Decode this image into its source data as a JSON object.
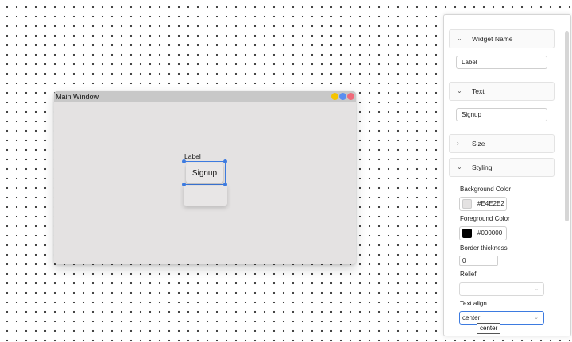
{
  "canvas": {
    "window_title": "Main Window",
    "window_buttons": [
      {
        "name": "minimize-dot",
        "color": "#f5c400"
      },
      {
        "name": "maximize-dot",
        "color": "#5b8ef0"
      },
      {
        "name": "close-dot",
        "color": "#f06a7a"
      }
    ],
    "label_text": "Label",
    "selected_button_text": "Signup"
  },
  "panel": {
    "widget_name": {
      "heading": "Widget Name",
      "value": "Label"
    },
    "text": {
      "heading": "Text",
      "value": "Signup"
    },
    "size": {
      "heading": "Size"
    },
    "styling": {
      "heading": "Styling",
      "bg_label": "Background Color",
      "bg_value": "#E4E2E2",
      "bg_swatch": "#e4e2e2",
      "fg_label": "Foreground Color",
      "fg_value": "#000000",
      "fg_swatch": "#000000",
      "border_label": "Border thickness",
      "border_value": "0",
      "relief_label": "Relief",
      "relief_value": "",
      "align_label": "Text align",
      "align_value": "center"
    }
  },
  "tooltip": "center"
}
